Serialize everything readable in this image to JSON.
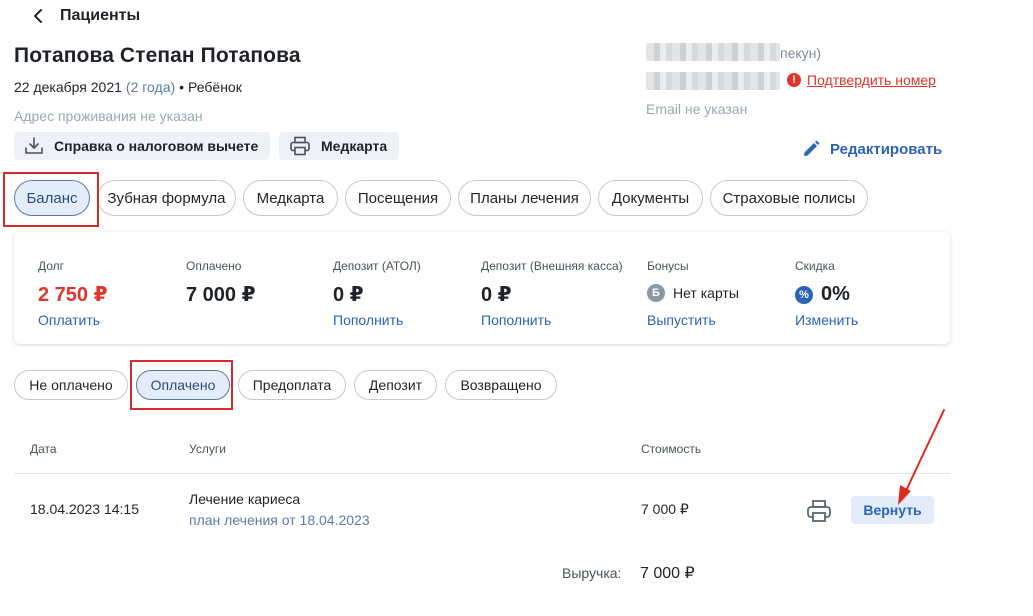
{
  "nav": {
    "back_label": "Пациенты"
  },
  "patient": {
    "name": "Потапова Степан Потапова",
    "dob": "22 декабря 2021",
    "age": "(2 года)",
    "separator": "•",
    "category": "Ребёнок",
    "address": "Адрес проживания не указан"
  },
  "contacts": {
    "guardian_suffix": "пекун)",
    "warning_glyph": "!",
    "confirm_link": "Подтвердить номер",
    "email": "Email не указан"
  },
  "actions": {
    "tax_button": "Справка о налоговом вычете",
    "medcard_button": "Медкарта",
    "edit_button": "Редактировать"
  },
  "tabs": [
    {
      "label": "Баланс",
      "active": true
    },
    {
      "label": "Зубная формула",
      "active": false
    },
    {
      "label": "Медкарта",
      "active": false
    },
    {
      "label": "Посещения",
      "active": false
    },
    {
      "label": "Планы лечения",
      "active": false
    },
    {
      "label": "Документы",
      "active": false
    },
    {
      "label": "Страховые полисы",
      "active": false
    }
  ],
  "balance": {
    "debt": {
      "label": "Долг",
      "value": "2 750 ₽",
      "link": "Оплатить"
    },
    "paid": {
      "label": "Оплачено",
      "value": "7 000 ₽"
    },
    "deposit_atol": {
      "label": "Депозит (АТОЛ)",
      "value": "0 ₽",
      "link": "Пополнить"
    },
    "deposit_external": {
      "label": "Депозит (Внешняя касса)",
      "value": "0 ₽",
      "link": "Пополнить"
    },
    "bonuses": {
      "label": "Бонусы",
      "badge": "Б",
      "value": "Нет карты",
      "link": "Выпустить"
    },
    "discount": {
      "label": "Скидка",
      "badge": "%",
      "value": "0%",
      "link": "Изменить"
    }
  },
  "filters": [
    {
      "label": "Не оплачено",
      "active": false
    },
    {
      "label": "Оплачено",
      "active": true
    },
    {
      "label": "Предоплата",
      "active": false
    },
    {
      "label": "Депозит",
      "active": false
    },
    {
      "label": "Возвращено",
      "active": false
    }
  ],
  "table": {
    "headers": {
      "date": "Дата",
      "services": "Услуги",
      "cost": "Стоимость"
    },
    "rows": [
      {
        "date": "18.04.2023 14:15",
        "service": "Лечение кариеса",
        "plan": "план лечения от 18.04.2023",
        "cost": "7 000 ₽",
        "refund_label": "Вернуть"
      }
    ]
  },
  "summary": {
    "revenue_label": "Выручка:",
    "revenue_value": "7 000 ₽"
  },
  "colors": {
    "accent": "#2b63b5",
    "danger": "#e0352b",
    "active_tab_bg": "#e3ecf8",
    "highlight": "#d62b2b"
  },
  "icons": [
    "chevron-left-icon",
    "download-icon",
    "printer-icon",
    "pencil-icon",
    "warning-icon",
    "arrow-annotation"
  ]
}
